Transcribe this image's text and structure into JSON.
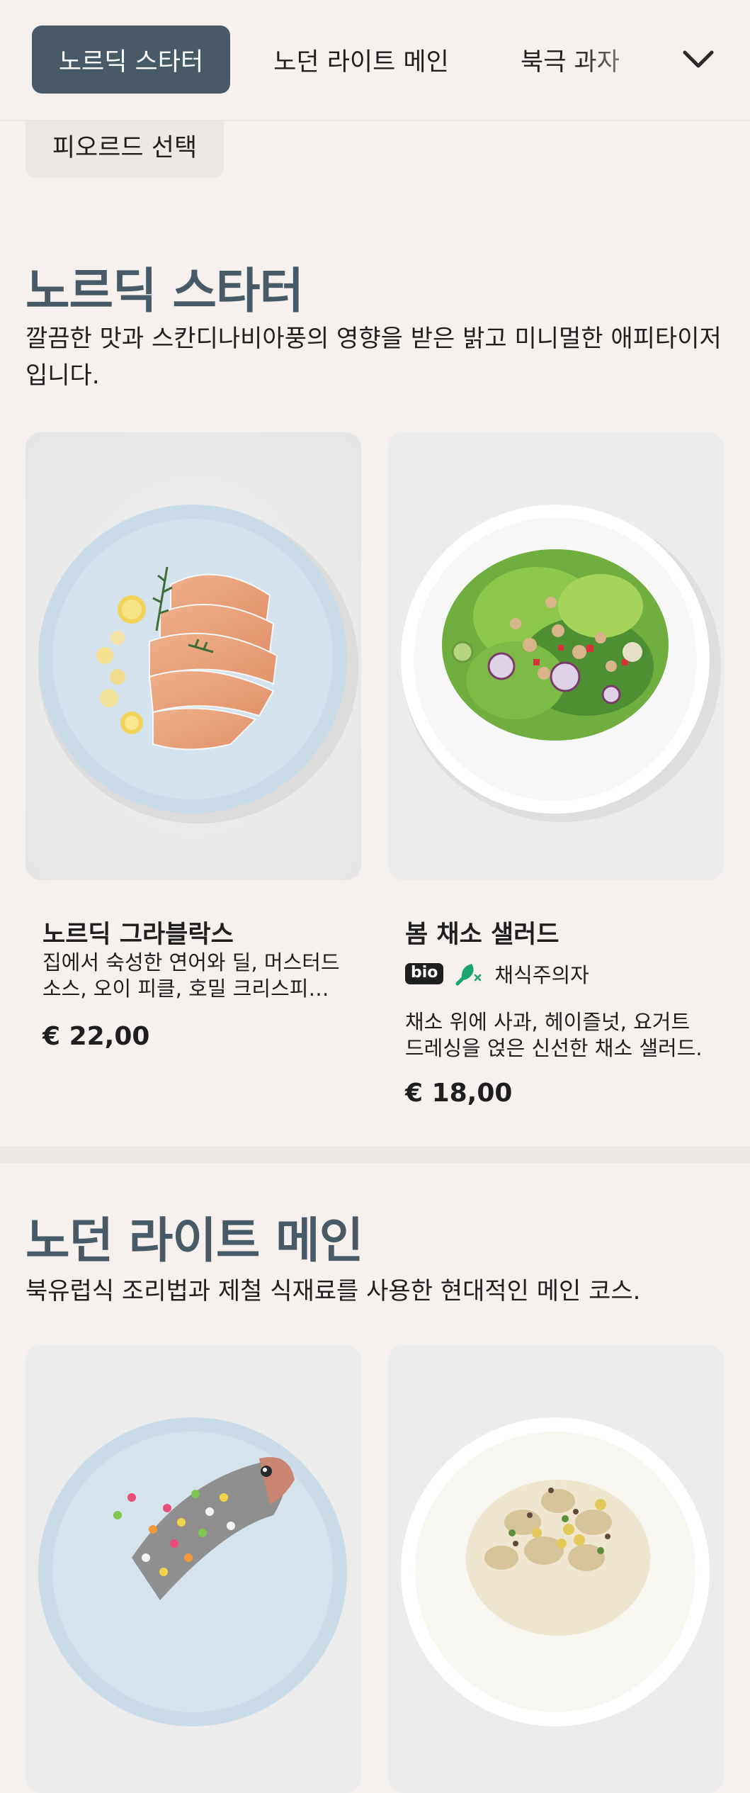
{
  "nav": {
    "tabs": [
      {
        "label": "노르딕 스타터"
      },
      {
        "label": "노던 라이트 메인"
      },
      {
        "label": "북극 과자"
      }
    ],
    "more_icon": "chevron-down-icon"
  },
  "filter_pill": {
    "label": "피오르드 선택"
  },
  "sections": [
    {
      "title": "노르딕 스타터",
      "description": "깔끔한 맛과 스칸디나비아풍의 영향을 받은 밝고 미니멀한 애피타이저입니다.",
      "dishes": [
        {
          "name": "노르딕 그라블락스",
          "description": "집에서 숙성한 연어와 딜, 머스터드 소스, 오이 피클, 호밀 크리스피를 곁들인 요리.",
          "price": "€ 22,00"
        },
        {
          "name": "봄 채소 샐러드",
          "tags": {
            "bio": "bio",
            "vegetarian_icon": "leaf-drumstick-icon",
            "vegetarian": "채식주의자"
          },
          "description": "채소 위에 사과, 헤이즐넛, 요거트 드레싱을 얹은 신선한 채소 샐러드.",
          "price": "€ 18,00"
        }
      ]
    },
    {
      "title": "노던 라이트 메인",
      "description": "북유럽식 조리법과 제철 식재료를 사용한 현대적인 메인 코스."
    }
  ],
  "colors": {
    "background": "#f6f1ee",
    "accent": "#475a66",
    "veg_green": "#1aa56b"
  }
}
